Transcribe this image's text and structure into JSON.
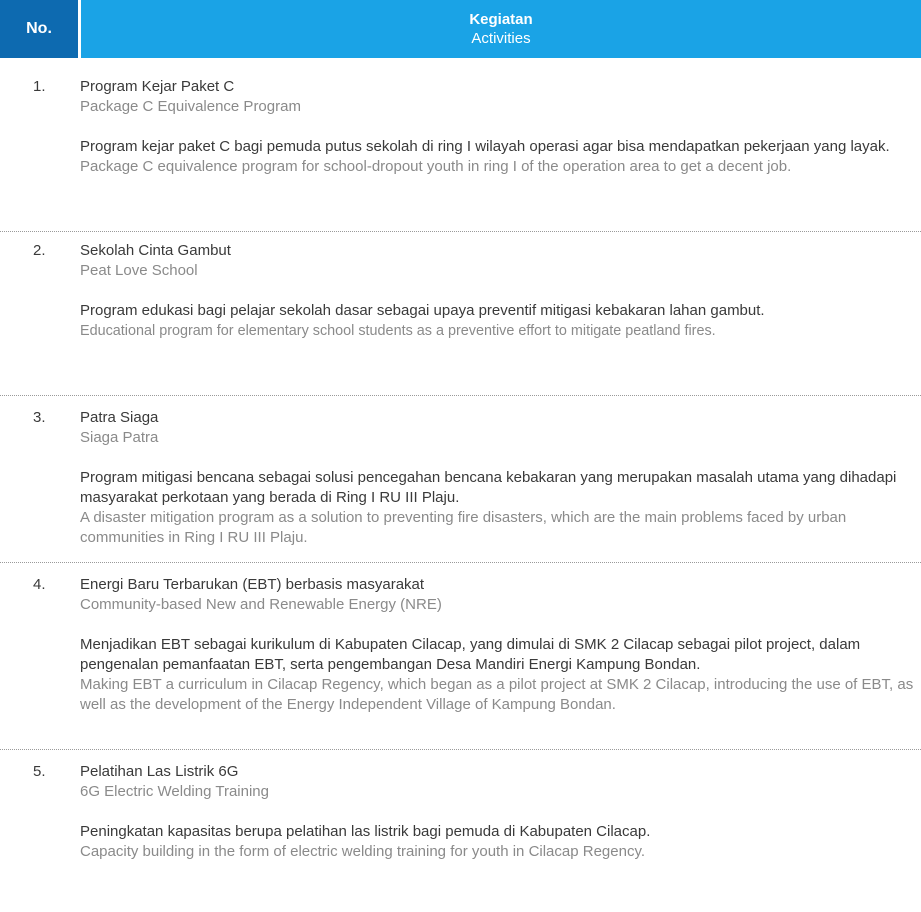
{
  "header": {
    "no_label": "No.",
    "activities_id": "Kegiatan",
    "activities_en": "Activities"
  },
  "rows": [
    {
      "number": "1.",
      "title_id": "Program Kejar Paket C",
      "title_en": "Package C Equivalence Program",
      "desc_id": "Program kejar paket C bagi pemuda putus sekolah di ring I wilayah operasi agar bisa mendapatkan pekerjaan yang layak.",
      "desc_en": "Package C equivalence program for school-dropout youth in ring I of the operation area to get a decent job."
    },
    {
      "number": "2.",
      "title_id": "Sekolah Cinta Gambut",
      "title_en": "Peat Love School",
      "desc_id": "Program edukasi bagi pelajar sekolah dasar sebagai upaya preventif mitigasi kebakaran lahan gambut.",
      "desc_en": "Educational program for elementary school students as a preventive effort to mitigate peatland fires."
    },
    {
      "number": "3.",
      "title_id": "Patra Siaga",
      "title_en": "Siaga Patra",
      "desc_id": "Program mitigasi bencana sebagai solusi pencegahan bencana kebakaran yang merupakan masalah utama yang dihadapi masyarakat perkotaan yang berada di Ring I RU III Plaju.",
      "desc_en": "A disaster mitigation program as a solution to preventing fire disasters, which are the main problems faced by urban communities in Ring I RU III Plaju."
    },
    {
      "number": "4.",
      "title_id": "Energi Baru Terbarukan (EBT) berbasis masyarakat",
      "title_en": "Community-based New and Renewable Energy (NRE)",
      "desc_id": "Menjadikan EBT sebagai kurikulum di Kabupaten Cilacap, yang dimulai di SMK 2 Cilacap sebagai pilot project, dalam pengenalan pemanfaatan EBT, serta pengembangan Desa Mandiri Energi Kampung Bondan.",
      "desc_en": "Making EBT a curriculum in Cilacap Regency, which began as a pilot project at SMK 2 Cilacap, introducing the use of EBT, as well as the development of the Energy Independent Village of Kampung Bondan."
    },
    {
      "number": "5.",
      "title_id": "Pelatihan Las Listrik 6G",
      "title_en": "6G Electric Welding Training",
      "desc_id": "Peningkatan kapasitas berupa pelatihan las listrik bagi pemuda di Kabupaten Cilacap.",
      "desc_en": "Capacity building in the form of electric welding training for youth in Cilacap Regency."
    }
  ]
}
